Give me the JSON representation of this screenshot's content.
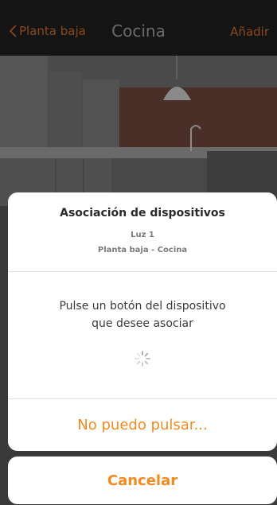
{
  "navbar": {
    "back_label": "Planta baja",
    "title": "Cocina",
    "add_label": "Añadir"
  },
  "sheet": {
    "title": "Asociación de dispositivos",
    "device": "Luz 1",
    "location": "Planta baja - Cocina",
    "instruction_line1": "Pulse un botón del dispositivo",
    "instruction_line2": "que desee asociar",
    "action_label": "No puedo pulsar..."
  },
  "cancel_label": "Cancelar",
  "colors": {
    "accent": "#f28a1f",
    "accent_dimmed": "#8a4a1b",
    "nav_bg": "#141414",
    "sheet_bg": "#ffffff"
  },
  "icons": {
    "back": "chevron-left-icon",
    "loading": "spinner-icon"
  }
}
